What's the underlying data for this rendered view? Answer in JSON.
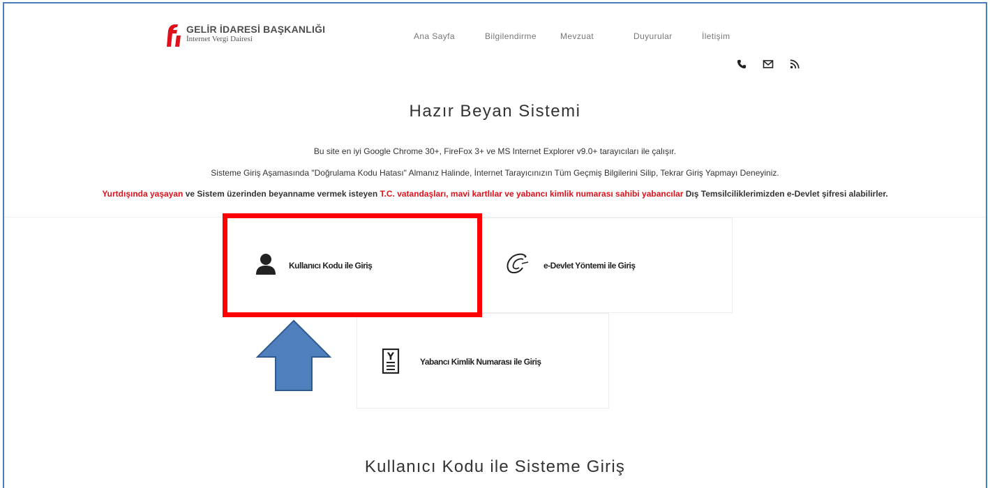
{
  "header": {
    "logo_title": "GELİR İDARESİ BAŞKANLIĞI",
    "logo_subtitle": "İnternet Vergi Dairesi",
    "brand_color": "#e0101b"
  },
  "nav": {
    "items": [
      {
        "label": "Ana Sayfa"
      },
      {
        "label": "Bilgilendirme"
      },
      {
        "label": "Mevzuat"
      },
      {
        "label": "Duyurular"
      },
      {
        "label": "İletişim"
      }
    ]
  },
  "contact_icons": [
    "phone-icon",
    "mail-icon",
    "rss-icon"
  ],
  "page_title": "Hazır Beyan Sistemi",
  "info": {
    "browser_note": "Bu site en iyi Google Chrome 30+, FireFox 3+ ve MS Internet Explorer v9.0+ tarayıcıları ile çalışır.",
    "captcha_note": "Sisteme Giriş Aşamasında \"Doğrulama Kodu Hatası\" Almanız Halinde, İnternet Tarayıcınızın Tüm Geçmiş Bilgilerini Silip, Tekrar Giriş Yapmayı Deneyiniz.",
    "abroad_part1": "Yurtdışında yaşayan",
    "abroad_part2": " ve Sistem üzerinden beyanname vermek isteyen ",
    "abroad_part3": "T.C. vatandaşları, mavi kartlılar ve yabancı kimlik numarası sahibi yabancılar",
    "abroad_part4": " Dış Temsilciliklerimizden e-Devlet şifresi alabilirler."
  },
  "login_options": {
    "user_code": "Kullanıcı Kodu ile Giriş",
    "edevlet": "e-Devlet Yöntemi ile Giriş",
    "foreign_id": "Yabancı Kimlik Numarası ile Giriş"
  },
  "annotation": {
    "highlight_color": "#ff0000",
    "arrow_color": "#4f7fbd"
  },
  "section_title": "Kullanıcı Kodu ile Sisteme Giriş"
}
